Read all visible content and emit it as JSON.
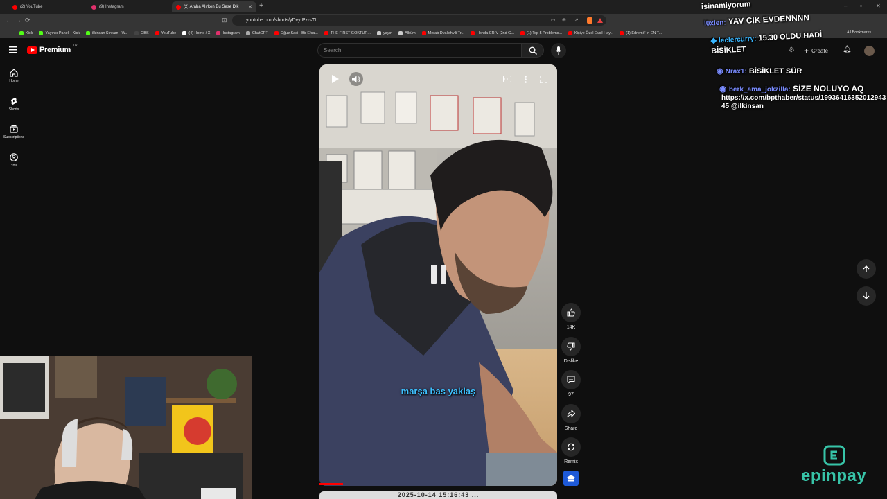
{
  "browser": {
    "tabs": [
      {
        "label": "(2) YouTube",
        "color": "#ff0000"
      },
      {
        "label": "(9) Instagram",
        "color": "#e1306c"
      },
      {
        "label": "(2) Araba Alırken Bu Sese Dik",
        "color": "#ff0000"
      }
    ],
    "url": "youtube.com/shorts/yDvyrPzrsTI",
    "bookmarks": [
      {
        "label": "Kick",
        "color": "#53fc18"
      },
      {
        "label": "Yayıncı Paneli | Kick",
        "color": "#53fc18"
      },
      {
        "label": "ilkinsan Stream - W...",
        "color": "#53fc18"
      },
      {
        "label": "OBS",
        "color": "#444444"
      },
      {
        "label": "YouTube",
        "color": "#ff0000"
      },
      {
        "label": "(4) Home / X",
        "color": "#ffffff"
      },
      {
        "label": "Instagram",
        "color": "#e1306c"
      },
      {
        "label": "ChatGPT",
        "color": "#aaaaaa"
      },
      {
        "label": "Oğuz Sasi - Bir Efsa...",
        "color": "#ff0000"
      },
      {
        "label": "THE FIRST GOKTUR...",
        "color": "#ff0000"
      },
      {
        "label": "yayın",
        "color": "#cccccc"
      },
      {
        "label": "Albüm",
        "color": "#cccccc"
      },
      {
        "label": "Merab Dvalishvili Tr...",
        "color": "#ff0000"
      },
      {
        "label": "Honda CR-V (2nd G...",
        "color": "#ff0000"
      },
      {
        "label": "(1) Top 5 Problems...",
        "color": "#ff0000"
      },
      {
        "label": "Kişiye Özel Evcil Hay...",
        "color": "#ff0000"
      },
      {
        "label": "(1) Edremit' in EN T...",
        "color": "#ff0000"
      }
    ],
    "all_bookmarks": "All Bookmarks"
  },
  "youtube": {
    "logo": "Premium",
    "region": "TR",
    "search_placeholder": "Search",
    "create": "Create",
    "sidebar": [
      {
        "label": "Home",
        "icon": "home-icon"
      },
      {
        "label": "Shorts",
        "icon": "shorts-icon"
      },
      {
        "label": "Subscriptions",
        "icon": "subscriptions-icon"
      },
      {
        "label": "You",
        "icon": "you-icon"
      }
    ],
    "caption": "marşa bas yaklaş",
    "next_video_text": "2025-10-14 15:16:43 ...",
    "actions": {
      "like_count": "14K",
      "dislike_label": "Dislike",
      "comment_count": "97",
      "share_label": "Share",
      "remix_label": "Remix"
    },
    "progress": 0.1
  },
  "chat": {
    "lines": [
      {
        "user": "",
        "text": "isinamiyorum",
        "user_color": "#ffffff"
      },
      {
        "user": "l0xien:",
        "text": "YAV CIK EVDENNNN",
        "user_color": "#7a8cff"
      },
      {
        "user": "leclercurry:",
        "text": "15.30 OLDU HADİ BİSİKLET",
        "user_color": "#38b6ff"
      },
      {
        "user": "Nrax1:",
        "text": "BİSİKLET SÜR",
        "user_color": "#7a8cff"
      },
      {
        "user": "berk_ama_jokzilla:",
        "text": "SİZE NOLUYO AQ",
        "user_color": "#7a8cff"
      },
      {
        "user": "",
        "text": "https://x.com/bpthaber/status/1993641635201294345 @ilkinsan",
        "user_color": "#ffffff"
      }
    ]
  },
  "brand": {
    "name": "epinpay",
    "color": "#37c4a8"
  }
}
